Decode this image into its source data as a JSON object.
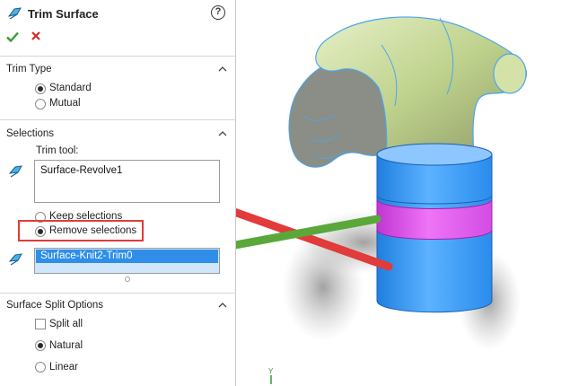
{
  "panel": {
    "title": "Trim Surface",
    "help_icon": "?"
  },
  "trim_type": {
    "title": "Trim Type",
    "options": [
      {
        "label": "Standard",
        "selected": true
      },
      {
        "label": "Mutual",
        "selected": false
      }
    ]
  },
  "selections": {
    "title": "Selections",
    "trim_tool_label": "Trim tool:",
    "trim_tool_value": "Surface-Revolve1",
    "keep_label": "Keep selections",
    "remove_label": "Remove selections",
    "removed_item": "Surface-Knit2-Trim0"
  },
  "split_options": {
    "title": "Surface Split Options",
    "split_all_label": "Split all",
    "natural_label": "Natural",
    "linear_label": "Linear"
  },
  "triad": {
    "y_label": "Y"
  },
  "colors": {
    "accent_red": "#e23b3b",
    "accent_green": "#5aa83a",
    "selected_blue": "#2f8fe8",
    "model_blue": "#3c9cf0",
    "trim_band_magenta": "#e060ea"
  }
}
